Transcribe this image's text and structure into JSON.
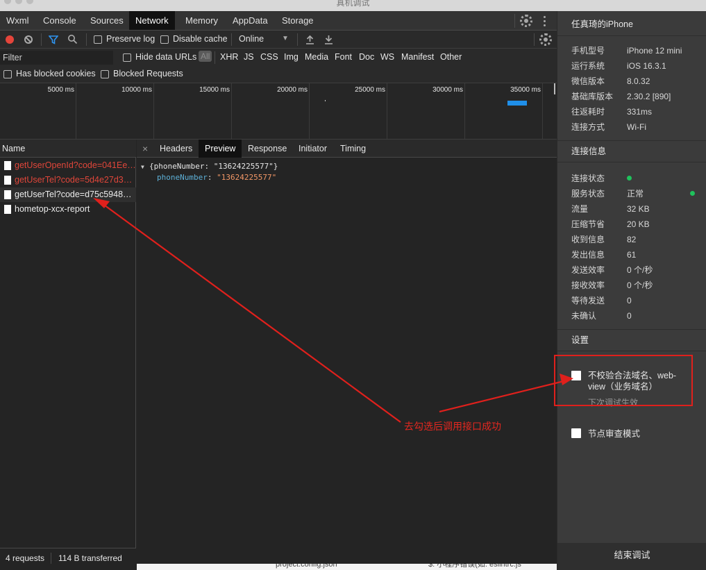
{
  "window": {
    "title": "真机调试"
  },
  "devtools_tabs": [
    "Wxml",
    "Console",
    "Sources",
    "Network",
    "Memory",
    "AppData",
    "Storage"
  ],
  "active_tab": "Network",
  "toolbar": {
    "preserve_log": "Preserve log",
    "disable_cache": "Disable cache",
    "throttle": "Online",
    "throttle_arrow": "▼"
  },
  "filter": {
    "placeholder": "Filter",
    "hide_data_urls": "Hide data URLs",
    "types": [
      "All",
      "XHR",
      "JS",
      "CSS",
      "Img",
      "Media",
      "Font",
      "Doc",
      "WS",
      "Manifest",
      "Other"
    ]
  },
  "blocked": {
    "cookies": "Has blocked cookies",
    "requests": "Blocked Requests"
  },
  "timeline": {
    "ticks": [
      "5000 ms",
      "10000 ms",
      "15000 ms",
      "20000 ms",
      "25000 ms",
      "30000 ms",
      "35000 ms"
    ]
  },
  "requests": {
    "header": "Name",
    "items": [
      {
        "name": "getUserOpenId?code=041Ee…",
        "status": "error"
      },
      {
        "name": "getUserTel?code=5d4e27d3…",
        "status": "error"
      },
      {
        "name": "getUserTel?code=d75c59488…",
        "status": "ok"
      },
      {
        "name": "hometop-xcx-report",
        "status": "ok"
      }
    ]
  },
  "footer": {
    "requests": "4 requests",
    "transferred": "114 B transferred"
  },
  "detail": {
    "close": "×",
    "tabs": [
      "Headers",
      "Preview",
      "Response",
      "Initiator",
      "Timing"
    ],
    "active": "Preview",
    "summary_arrow": "▼",
    "summary": "{phoneNumber: \"13624225577\"}",
    "key": "phoneNumber",
    "colon": ": ",
    "value": "\"13624225577\""
  },
  "sidebar": {
    "device_title": "任真琦的iPhone",
    "device_info": [
      {
        "k": "手机型号",
        "v": "iPhone 12 mini"
      },
      {
        "k": "运行系统",
        "v": "iOS 16.3.1"
      },
      {
        "k": "微信版本",
        "v": "8.0.32"
      },
      {
        "k": "基础库版本",
        "v": "2.30.2 [890]"
      },
      {
        "k": "往返耗时",
        "v": "331ms"
      },
      {
        "k": "连接方式",
        "v": "Wi-Fi"
      }
    ],
    "conn_title": "连接信息",
    "conn_info": [
      {
        "k": "连接状态",
        "v": ""
      },
      {
        "k": "服务状态",
        "v": "正常"
      },
      {
        "k": "流量",
        "v": "32 KB"
      },
      {
        "k": "压缩节省",
        "v": "20 KB"
      },
      {
        "k": "收到信息",
        "v": "82"
      },
      {
        "k": "发出信息",
        "v": "61"
      },
      {
        "k": "发送效率",
        "v": "0 个/秒"
      },
      {
        "k": "接收效率",
        "v": "0 个/秒"
      },
      {
        "k": "等待发送",
        "v": "0"
      },
      {
        "k": "未确认",
        "v": "0"
      }
    ],
    "settings_title": "设置",
    "setting1_line1": "不校验合法域名、web-",
    "setting1_line2": "view（业务域名）",
    "setting1_note": "下次调试生效",
    "setting2": "节点审查模式",
    "end_button": "结束调试",
    "status_green": "#1fc25c"
  },
  "annotation": {
    "text": "去勾选后调用接口成功",
    "color": "#e5271f"
  },
  "bottom_strip": {
    "left": "project.config.json",
    "right": "$: 小程序错误(如: eslintrc.js"
  }
}
